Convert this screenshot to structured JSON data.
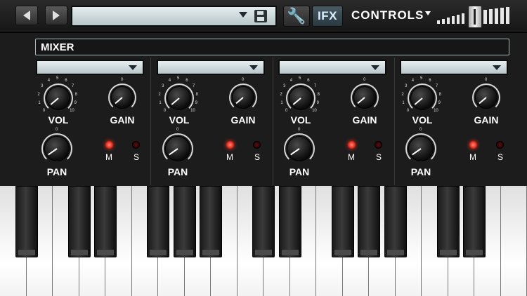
{
  "toolbar": {
    "preset_value": "",
    "ifx_label": "IFX",
    "controls_label": "CONTROLS",
    "volume_level": 0.5
  },
  "mixer": {
    "title": "MIXER",
    "knob_scale": [
      "0",
      "1",
      "2",
      "3",
      "4",
      "5",
      "6",
      "7",
      "8",
      "9",
      "10"
    ],
    "gain_scale_label": "0",
    "pan_scale_label": "0",
    "channels": [
      {
        "vol_label": "VOL",
        "gain_label": "GAIN",
        "pan_label": "PAN",
        "mute_label": "M",
        "solo_label": "S",
        "mute_on": true,
        "solo_on": false
      },
      {
        "vol_label": "VOL",
        "gain_label": "GAIN",
        "pan_label": "PAN",
        "mute_label": "M",
        "solo_label": "S",
        "mute_on": true,
        "solo_on": false
      },
      {
        "vol_label": "VOL",
        "gain_label": "GAIN",
        "pan_label": "PAN",
        "mute_label": "M",
        "solo_label": "S",
        "mute_on": true,
        "solo_on": false
      },
      {
        "vol_label": "VOL",
        "gain_label": "GAIN",
        "pan_label": "PAN",
        "mute_label": "M",
        "solo_label": "S",
        "mute_on": true,
        "solo_on": false
      }
    ]
  },
  "colors": {
    "led_on": "#e0281a",
    "select_bg": "#c8d4d8",
    "background": "#1c1c1c"
  },
  "icons": [
    "previous-icon",
    "next-icon",
    "dropdown-caret-icon",
    "save-icon",
    "wrench-icon",
    "volume-bars-icon"
  ]
}
